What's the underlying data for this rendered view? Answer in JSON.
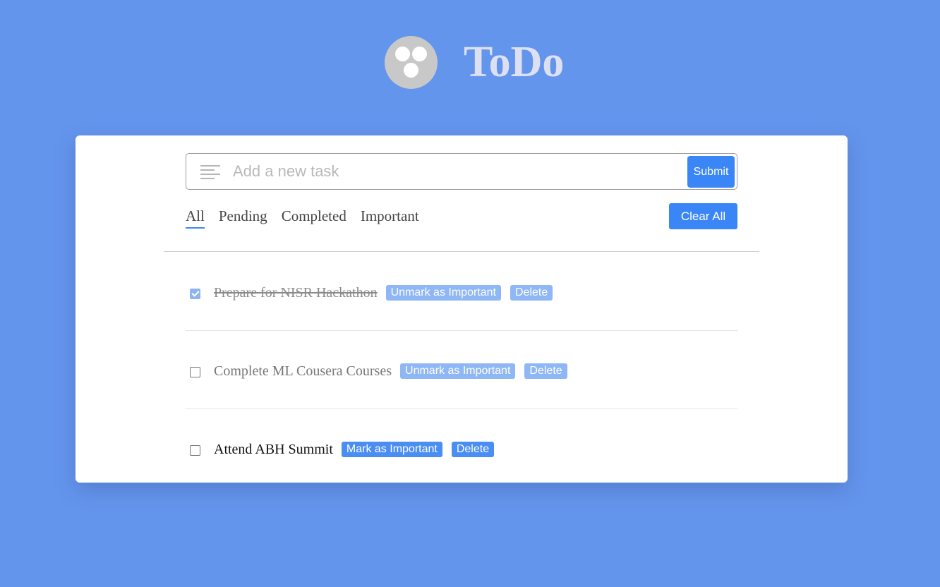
{
  "header": {
    "title": "ToDo",
    "logo_icon": "logo-icon"
  },
  "form": {
    "placeholder": "Add a new task",
    "submit_label": "Submit"
  },
  "tabs": [
    {
      "label": "All",
      "active": true
    },
    {
      "label": "Pending",
      "active": false
    },
    {
      "label": "Completed",
      "active": false
    },
    {
      "label": "Important",
      "active": false
    }
  ],
  "clear_all_label": "Clear All",
  "tasks": [
    {
      "text": "Prepare for NISR Hackathon",
      "completed": true,
      "important": true,
      "important_label": "Unmark as Important",
      "delete_label": "Delete"
    },
    {
      "text": "Complete ML Cousera Courses",
      "completed": false,
      "important": true,
      "important_label": "Unmark as Important",
      "delete_label": "Delete"
    },
    {
      "text": "Attend ABH Summit",
      "completed": false,
      "important": false,
      "important_label": "Mark as Important",
      "delete_label": "Delete"
    }
  ],
  "colors": {
    "background": "#6495ed",
    "accent": "#3b86f7",
    "card": "#ffffff"
  }
}
